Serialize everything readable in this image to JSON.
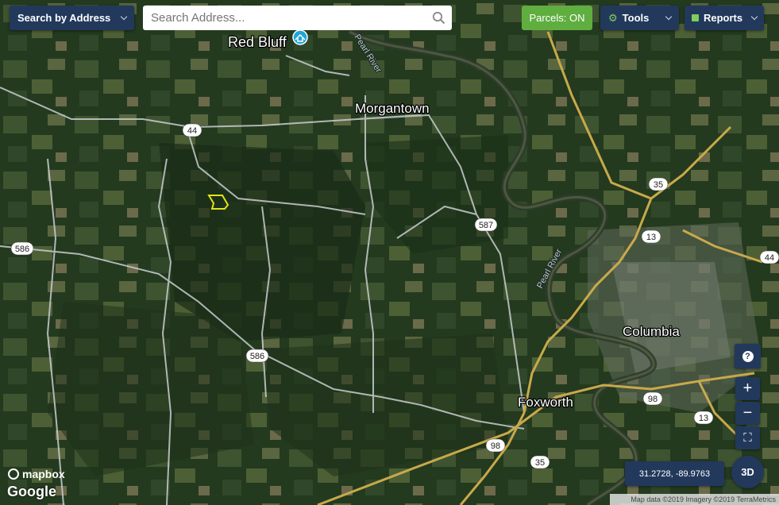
{
  "header": {
    "search_mode_label": "Search by Address",
    "search_placeholder": "Search Address...",
    "parcels_label": "Parcels: ON",
    "tools_label": "Tools",
    "reports_label": "Reports"
  },
  "map": {
    "places": [
      "Red Bluff",
      "Morgantown",
      "Columbia",
      "Foxworth"
    ],
    "rivers": [
      "Pearl River",
      "Pearl River"
    ],
    "route_shields": [
      "44",
      "35",
      "587",
      "586",
      "13",
      "44",
      "586",
      "98",
      "98",
      "13",
      "35"
    ]
  },
  "controls": {
    "help_label": "?",
    "zoom_in_label": "+",
    "zoom_out_label": "−",
    "fullscreen_label": "⛶",
    "coordinates": "31.2728, -89.9763",
    "view_3d_label": "3D"
  },
  "branding": {
    "mapbox": "mapbox",
    "google": "Google",
    "attribution": "Map data ©2019 Imagery ©2019 TerraMetrics"
  },
  "colors": {
    "navy": "#22395c",
    "parcels_green": "#5fae3f",
    "parcel_outline": "#e2e21c"
  }
}
